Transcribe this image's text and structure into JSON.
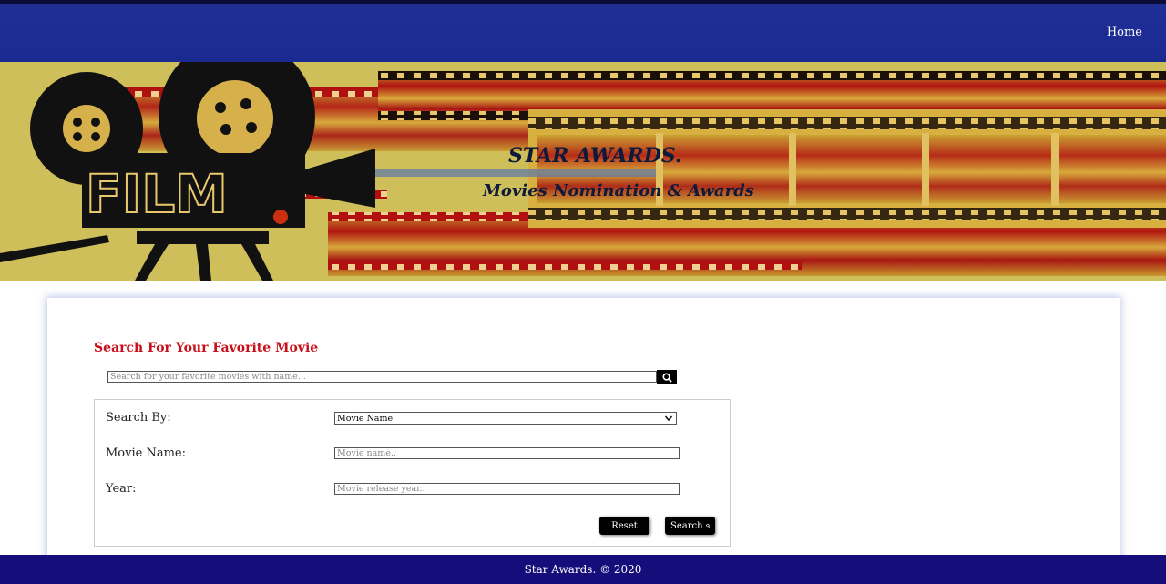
{
  "nav": {
    "home_label": "Home"
  },
  "banner": {
    "camera_text": "FILM",
    "title": "STAR AWARDS.",
    "subtitle": "Movies Nomination & Awards"
  },
  "search": {
    "heading": "Search For Your Favorite Movie",
    "quick_placeholder": "Search for your favorite movies with name...",
    "quick_icon": "search-icon"
  },
  "advanced": {
    "search_by_label": "Search By:",
    "search_by_value": "Movie Name",
    "movie_name_label": "Movie Name:",
    "movie_name_placeholder": "Movie name..",
    "year_label": "Year:",
    "year_placeholder": "Movie release year..",
    "reset_label": "Reset",
    "search_label": "Search"
  },
  "footer": {
    "text": "Star Awards. © 2020"
  },
  "colors": {
    "nav_bg": "#1f2f95",
    "heading_red": "#c8101a",
    "footer_bg": "#150d7a",
    "banner_gold": "#cfbf5a"
  }
}
